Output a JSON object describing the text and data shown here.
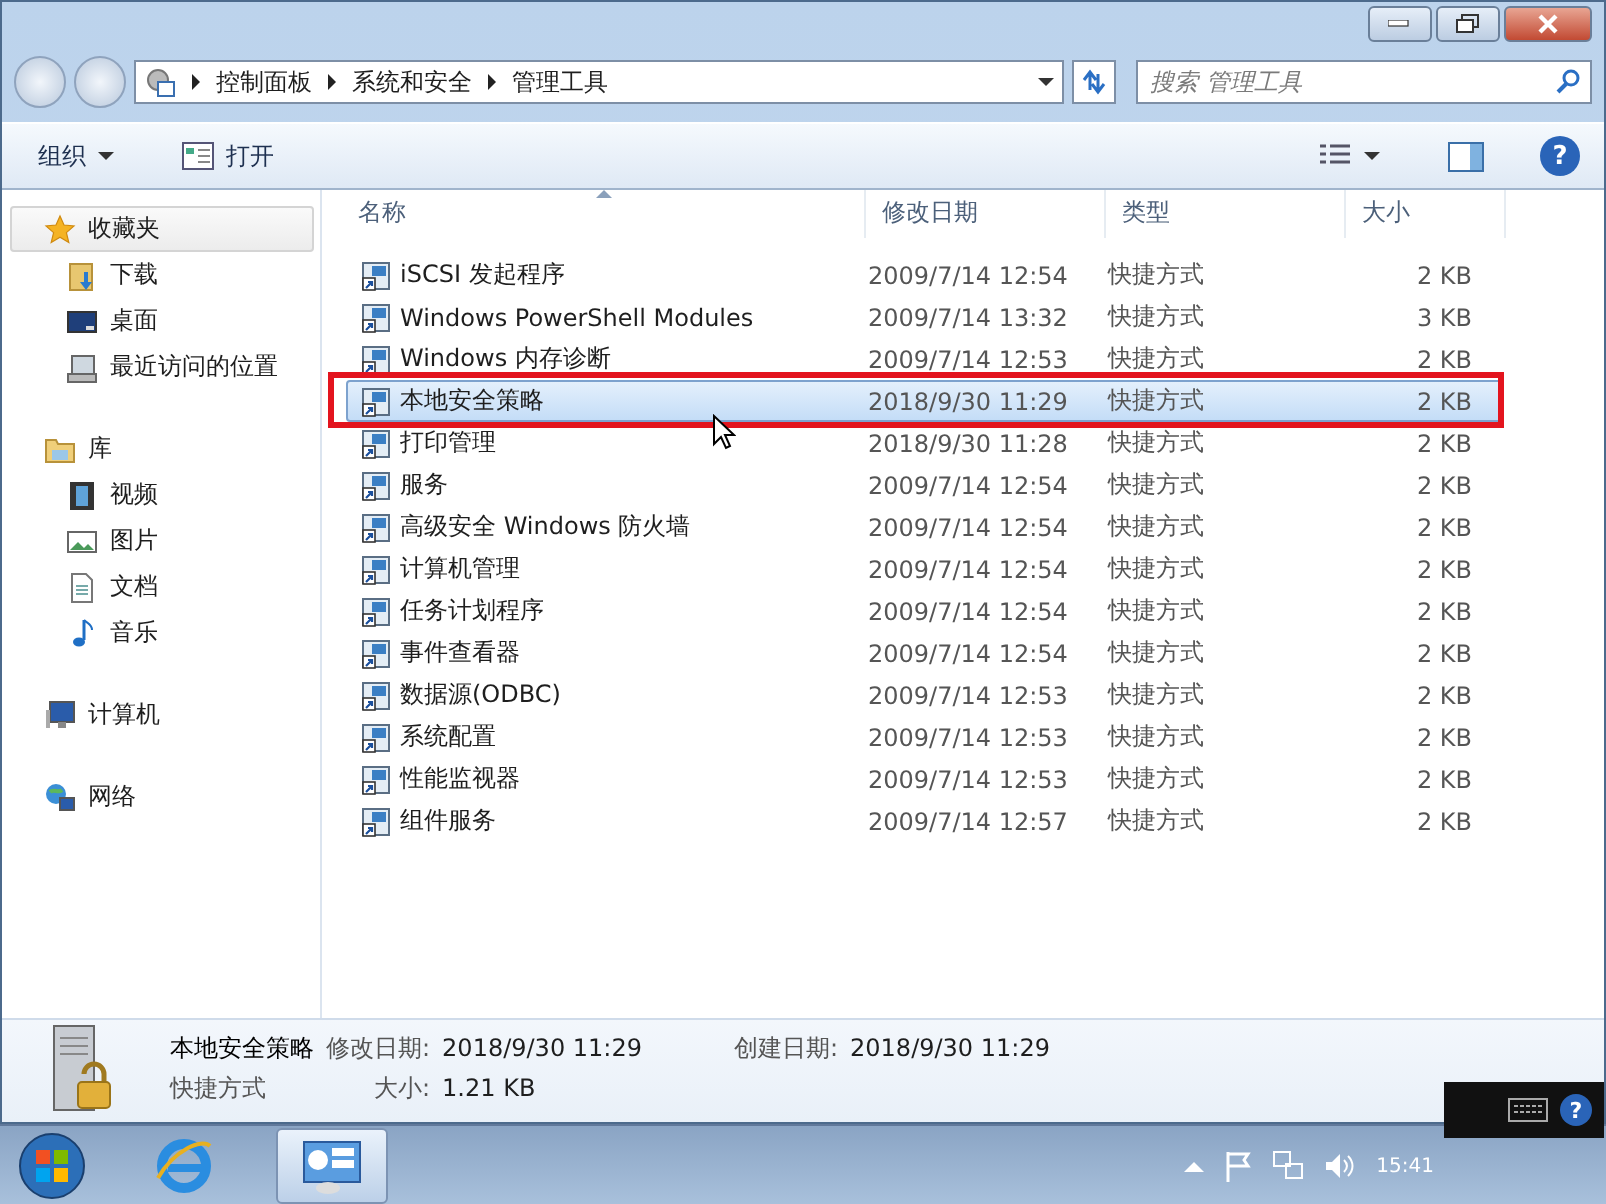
{
  "address": {
    "breadcrumbs": [
      "控制面板",
      "系统和安全",
      "管理工具"
    ]
  },
  "search": {
    "placeholder": "搜索 管理工具"
  },
  "toolbar": {
    "organize": "组织",
    "open": "打开",
    "help": "?"
  },
  "language_bar": {
    "help": "?"
  },
  "sidebar": [
    {
      "label": "收藏夹",
      "kind": "star",
      "selected": true,
      "children": [
        {
          "label": "下载",
          "kind": "download"
        },
        {
          "label": "桌面",
          "kind": "desktop"
        },
        {
          "label": "最近访问的位置",
          "kind": "recent"
        }
      ]
    },
    {
      "label": "库",
      "kind": "library",
      "selected": false,
      "children": [
        {
          "label": "视频",
          "kind": "video"
        },
        {
          "label": "图片",
          "kind": "picture"
        },
        {
          "label": "文档",
          "kind": "document"
        },
        {
          "label": "音乐",
          "kind": "music"
        }
      ]
    },
    {
      "label": "计算机",
      "kind": "computer",
      "selected": false
    },
    {
      "label": "网络",
      "kind": "network",
      "selected": false
    }
  ],
  "table": {
    "columns": [
      {
        "label": "名称",
        "sorted": true
      },
      {
        "label": "修改日期",
        "sorted": false
      },
      {
        "label": "类型",
        "sorted": false
      },
      {
        "label": "大小",
        "sorted": false
      }
    ],
    "rows": [
      {
        "name": "iSCSI 发起程序",
        "date": "2009/7/14 12:54",
        "type": "快捷方式",
        "size": "2 KB",
        "selected": false,
        "outlined": false
      },
      {
        "name": "Windows PowerShell Modules",
        "date": "2009/7/14 13:32",
        "type": "快捷方式",
        "size": "3 KB",
        "selected": false,
        "outlined": false
      },
      {
        "name": "Windows 内存诊断",
        "date": "2009/7/14 12:53",
        "type": "快捷方式",
        "size": "2 KB",
        "selected": false,
        "outlined": false
      },
      {
        "name": "本地安全策略",
        "date": "2018/9/30 11:29",
        "type": "快捷方式",
        "size": "2 KB",
        "selected": true,
        "outlined": true
      },
      {
        "name": "打印管理",
        "date": "2018/9/30 11:28",
        "type": "快捷方式",
        "size": "2 KB",
        "selected": false,
        "outlined": false
      },
      {
        "name": "服务",
        "date": "2009/7/14 12:54",
        "type": "快捷方式",
        "size": "2 KB",
        "selected": false,
        "outlined": false
      },
      {
        "name": "高级安全 Windows 防火墙",
        "date": "2009/7/14 12:54",
        "type": "快捷方式",
        "size": "2 KB",
        "selected": false,
        "outlined": false
      },
      {
        "name": "计算机管理",
        "date": "2009/7/14 12:54",
        "type": "快捷方式",
        "size": "2 KB",
        "selected": false,
        "outlined": false
      },
      {
        "name": "任务计划程序",
        "date": "2009/7/14 12:54",
        "type": "快捷方式",
        "size": "2 KB",
        "selected": false,
        "outlined": false
      },
      {
        "name": "事件查看器",
        "date": "2009/7/14 12:54",
        "type": "快捷方式",
        "size": "2 KB",
        "selected": false,
        "outlined": false
      },
      {
        "name": "数据源(ODBC)",
        "date": "2009/7/14 12:53",
        "type": "快捷方式",
        "size": "2 KB",
        "selected": false,
        "outlined": false
      },
      {
        "name": "系统配置",
        "date": "2009/7/14 12:53",
        "type": "快捷方式",
        "size": "2 KB",
        "selected": false,
        "outlined": false
      },
      {
        "name": "性能监视器",
        "date": "2009/7/14 12:53",
        "type": "快捷方式",
        "size": "2 KB",
        "selected": false,
        "outlined": false
      },
      {
        "name": "组件服务",
        "date": "2009/7/14 12:57",
        "type": "快捷方式",
        "size": "2 KB",
        "selected": false,
        "outlined": false
      }
    ]
  },
  "details": {
    "name": "本地安全策略",
    "type": "快捷方式",
    "modified_label": "修改日期:",
    "modified": "2018/9/30 11:29",
    "created_label": "创建日期:",
    "created": "2018/9/30 11:29",
    "size_label": "大小:",
    "size": "1.21 KB"
  },
  "taskbar": {
    "clock": "15:41"
  }
}
